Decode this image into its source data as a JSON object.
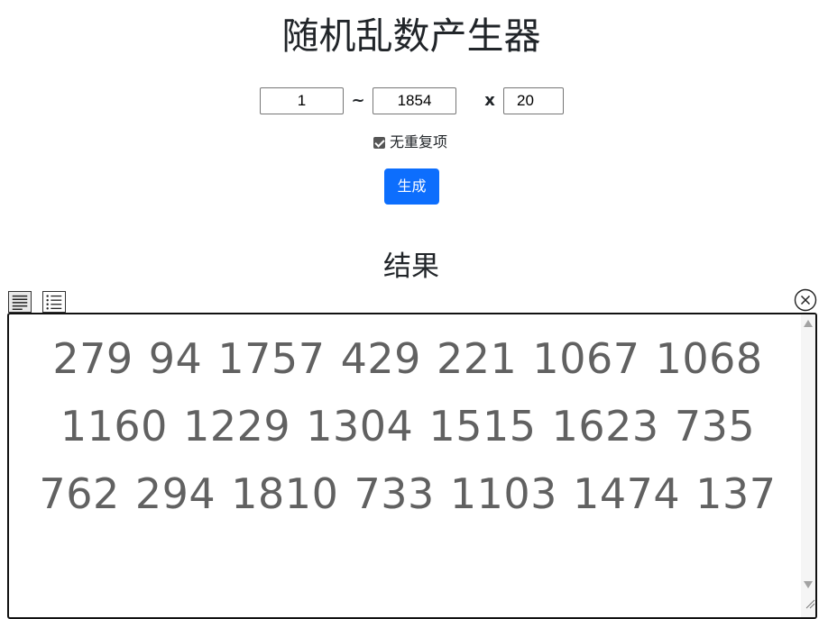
{
  "page": {
    "title": "随机乱数产生器"
  },
  "range": {
    "min": "1",
    "separator": "~",
    "max": "1854",
    "times_symbol": "x",
    "count": "20"
  },
  "options": {
    "unique_label": "无重复项",
    "unique_checked": true
  },
  "actions": {
    "generate_label": "生成"
  },
  "result": {
    "heading": "结果",
    "numbers_text": "279 94 1757 429 221 1067 1068 1160 1229 1304 1515 1623 735 762 294 1810 733 1103 1474 137"
  },
  "toolbar": {
    "icons": [
      "text-view-icon",
      "list-view-icon",
      "close-circle-icon"
    ]
  },
  "colors": {
    "accent": "#0d6efd",
    "result_text": "#616161",
    "title_text": "#212529"
  }
}
